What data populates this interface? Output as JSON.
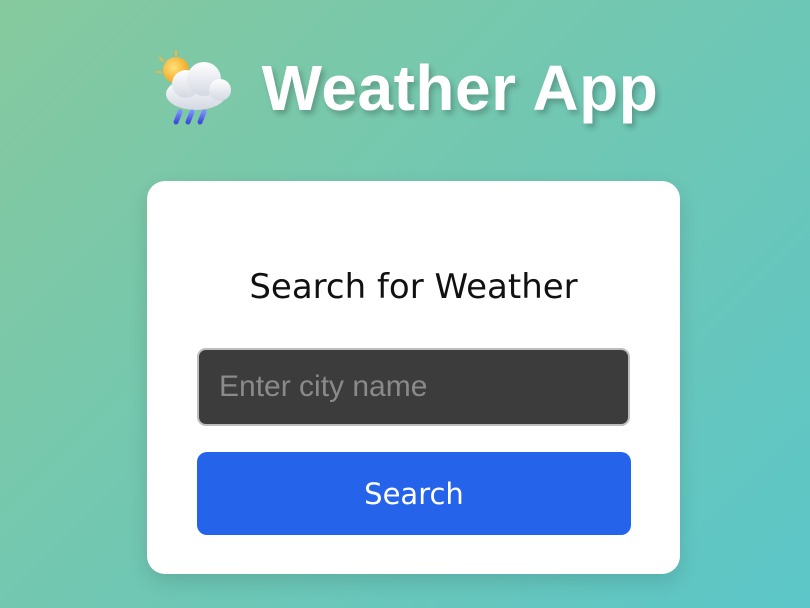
{
  "header": {
    "icon": "sun-behind-rain-cloud-icon",
    "title": "Weather App"
  },
  "search_card": {
    "title": "Search for Weather",
    "input_value": "",
    "input_placeholder": "Enter city name",
    "button_label": "Search"
  },
  "colors": {
    "background_start": "#86c99e",
    "background_end": "#5cc6c8",
    "card_background": "#ffffff",
    "input_background": "#3c3c3c",
    "button_accent": "#2563eb"
  }
}
